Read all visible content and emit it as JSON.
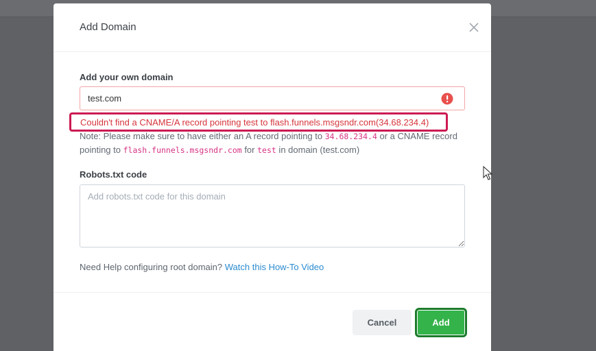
{
  "modal": {
    "title": "Add Domain",
    "domain_label": "Add your own domain",
    "domain_value": "test.com",
    "error_text": "Couldn't find a CNAME/A record pointing test to flash.funnels.msgsndr.com(34.68.234.4)",
    "note": {
      "part1": "Note: Please make sure to have either an A record pointing to ",
      "ip": "34.68.234.4",
      "part2": " or a CNAME record pointing to ",
      "host": "flash.funnels.msgsndr.com",
      "part3": " for ",
      "sub": "test",
      "part4": " in domain (test.com)"
    },
    "robots_label": "Robots.txt code",
    "robots_placeholder": "Add robots.txt code for this domain",
    "help_text": "Need Help configuring root domain? ",
    "help_link": "Watch this How-To Video",
    "cancel_label": "Cancel",
    "add_label": "Add"
  },
  "icons": {
    "close": "close-icon",
    "error": "exclamation-circle-icon",
    "cursor": "mouse-pointer-icon"
  },
  "colors": {
    "add_button": "#34b34a",
    "error_text": "#d6353b",
    "highlight_border": "#cc1a52",
    "link": "#2b8bd0",
    "code": "#d63384"
  }
}
